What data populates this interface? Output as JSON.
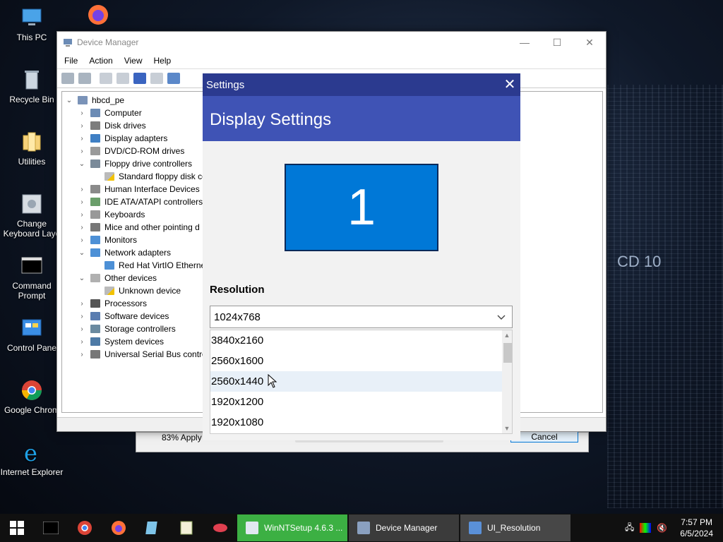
{
  "desktop": {
    "icons": [
      {
        "label": "This PC"
      },
      {
        "label": "Recycle Bin"
      },
      {
        "label": "Utilities"
      },
      {
        "label": "Change Keyboard Layo"
      },
      {
        "label": "Command Prompt"
      },
      {
        "label": "Control Pane"
      },
      {
        "label": "Google Chrom"
      },
      {
        "label": "Internet Explorer"
      }
    ],
    "background_text": "CD 10"
  },
  "device_manager": {
    "title": "Device Manager",
    "menu": [
      "File",
      "Action",
      "View",
      "Help"
    ],
    "tree": {
      "root": "hbcd_pe",
      "items": [
        {
          "label": "Computer",
          "expanded": false
        },
        {
          "label": "Disk drives",
          "expanded": false
        },
        {
          "label": "Display adapters",
          "expanded": false
        },
        {
          "label": "DVD/CD-ROM drives",
          "expanded": false
        },
        {
          "label": "Floppy drive controllers",
          "expanded": true
        },
        {
          "label": "Standard floppy disk co",
          "child": true,
          "warning": true
        },
        {
          "label": "Human Interface Devices",
          "expanded": false
        },
        {
          "label": "IDE ATA/ATAPI controllers",
          "expanded": false
        },
        {
          "label": "Keyboards",
          "expanded": false
        },
        {
          "label": "Mice and other pointing d",
          "expanded": false
        },
        {
          "label": "Monitors",
          "expanded": false
        },
        {
          "label": "Network adapters",
          "expanded": true
        },
        {
          "label": "Red Hat VirtIO Etherne",
          "child": true
        },
        {
          "label": "Other devices",
          "expanded": true
        },
        {
          "label": "Unknown device",
          "child": true,
          "warning": true
        },
        {
          "label": "Processors",
          "expanded": false
        },
        {
          "label": "Software devices",
          "expanded": false
        },
        {
          "label": "Storage controllers",
          "expanded": false
        },
        {
          "label": "System devices",
          "expanded": false
        },
        {
          "label": "Universal Serial Bus contro",
          "expanded": false
        }
      ]
    }
  },
  "winntsetup": {
    "percent_label": "83% Apply",
    "cancel_label": "Cancel"
  },
  "settings": {
    "title": "Settings",
    "header": "Display Settings",
    "monitor_number": "1",
    "resolution_label": "Resolution",
    "selected_resolution": "1024x768",
    "options": [
      "3840x2160",
      "2560x1600",
      "2560x1440",
      "1920x1200",
      "1920x1080"
    ],
    "hovered_option": "2560x1440"
  },
  "taskbar": {
    "tasks": [
      {
        "label": "WinNTSetup 4.6.3 ...",
        "color": "#3cb043"
      },
      {
        "label": "Device Manager",
        "color": "#4a4a4a"
      },
      {
        "label": "UI_Resolution",
        "color": "#5a5a5a"
      }
    ],
    "time": "7:57 PM",
    "date": "6/5/2024"
  },
  "colors": {
    "settings_title": "#2b3a8f",
    "settings_header": "#3f53b5",
    "monitor_preview": "#0078d7",
    "winnt_task": "#3cb043"
  }
}
